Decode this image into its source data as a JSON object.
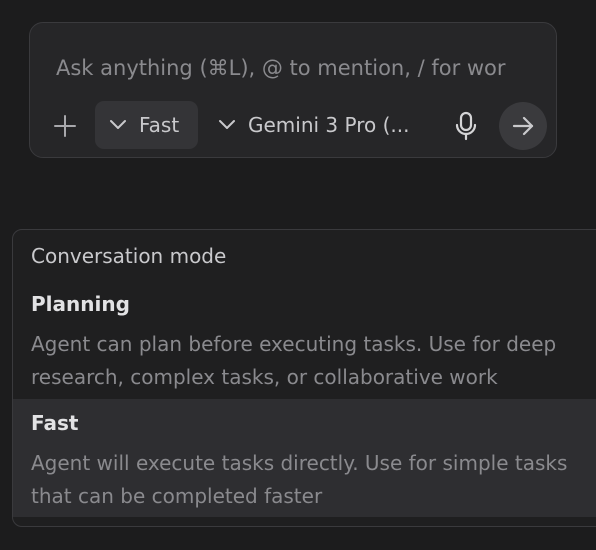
{
  "chat": {
    "placeholder": "Ask anything (⌘L), @ to mention, / for wor",
    "mode_label": "Fast",
    "model_label": "Gemini 3 Pro (...",
    "icons": {
      "add": "plus-icon",
      "mode_chevron": "chevron-down-icon",
      "model_chevron": "chevron-down-icon",
      "mic": "microphone-icon",
      "send": "arrow-right-icon"
    }
  },
  "mode_menu": {
    "header": "Conversation mode",
    "options": [
      {
        "title": "Planning",
        "description_lines": [
          "Agent can plan before executing tasks. Use for deep",
          "research, complex tasks, or collaborative work"
        ],
        "highlighted": false
      },
      {
        "title": "Fast",
        "description_lines": [
          "Agent will execute tasks directly. Use for simple tasks",
          "that can be completed faster"
        ],
        "highlighted": true
      }
    ]
  },
  "colors": {
    "background": "#1c1c1d",
    "input_panel": "#262628",
    "highlight": "#2e2e31",
    "muted_text": "#8a8a8e"
  }
}
